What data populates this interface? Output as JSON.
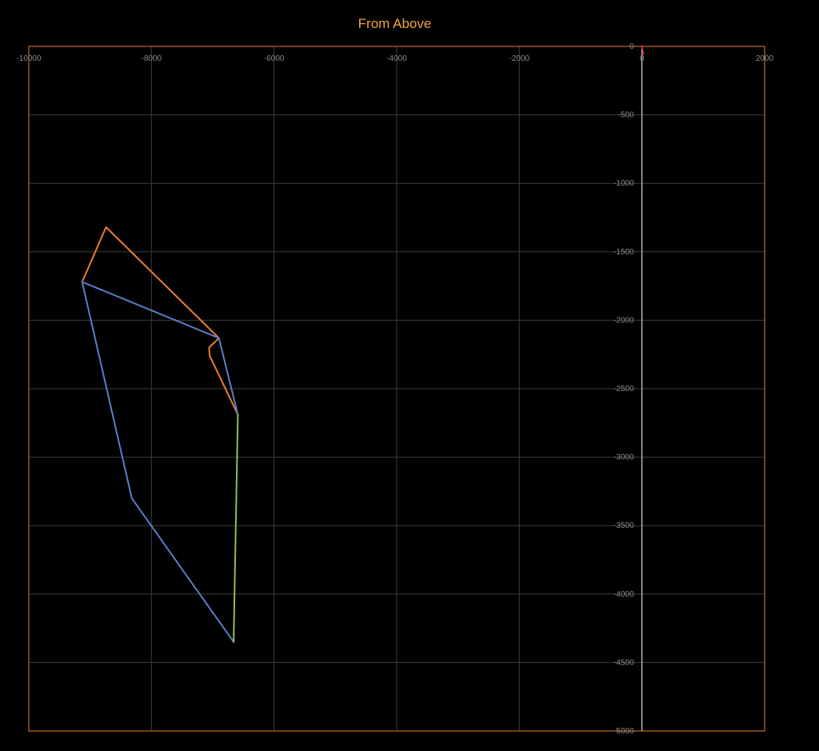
{
  "chart_data": {
    "type": "scatter",
    "title": "From Above",
    "xlabel": "",
    "ylabel": "",
    "xlim": [
      -10000,
      2000
    ],
    "ylim": [
      -5000,
      0
    ],
    "x_ticks": [
      -10000,
      -8000,
      -6000,
      -4000,
      -2000,
      0,
      2000
    ],
    "x_tick_labels": [
      "-10000",
      "-8000",
      "-6000",
      "-4000",
      "-2000",
      "0",
      "2000"
    ],
    "y_ticks": [
      0,
      -500,
      -1000,
      -1500,
      -2000,
      -2500,
      -3000,
      -3500,
      -4000,
      -4500,
      -5000
    ],
    "y_tick_labels": [
      "0",
      "-500",
      "-1000",
      "-1500",
      "-2000",
      "-2500",
      "-3000",
      "-3500",
      "-4000",
      "-4500",
      "-5000"
    ],
    "grid": true,
    "legend": "none",
    "colors": {
      "background": "#000000",
      "title": "#f0a43a",
      "plot_border": "#ed7d31",
      "grid": "#3c3c3c",
      "axis": "#ffffff",
      "tick_label": "#8a8a8a"
    },
    "series": [
      {
        "color": "#ed7d31",
        "x": [
          -9130,
          -8740,
          -6900,
          -7060,
          -7050,
          -6590
        ],
        "y": [
          -1720,
          -1320,
          -2130,
          -2200,
          -2260,
          -2690
        ]
      },
      {
        "color": "#5b7ec9",
        "x": [
          -9130,
          -6900,
          -6590
        ],
        "y": [
          -1720,
          -2130,
          -2690
        ]
      },
      {
        "color": "#5b7ec9",
        "x": [
          -9130,
          -8320,
          -6660
        ],
        "y": [
          -1720,
          -3300,
          -4350
        ]
      },
      {
        "color": "#92c04e",
        "x": [
          -6590,
          -6660
        ],
        "y": [
          -2690,
          -4350
        ]
      },
      {
        "color": "#e0245e",
        "x": [
          0,
          20
        ],
        "y": [
          0,
          -50
        ]
      }
    ]
  }
}
